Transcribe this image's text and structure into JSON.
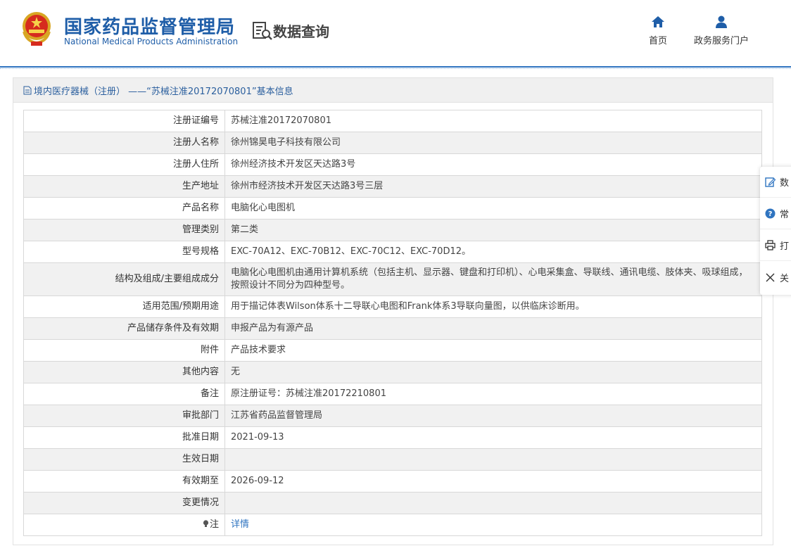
{
  "header": {
    "brand_cn": "国家药品监督管理局",
    "brand_en": "National Medical Products Administration",
    "section_title": "数据查询",
    "nav": [
      {
        "label": "首页",
        "icon": "home-icon"
      },
      {
        "label": "政务服务门户",
        "icon": "user-icon"
      }
    ]
  },
  "panel": {
    "title": "境内医疗器械（注册） ——“苏械注准20172070801”基本信息"
  },
  "rows": [
    {
      "label": "注册证编号",
      "value": "苏械注准20172070801"
    },
    {
      "label": "注册人名称",
      "value": "徐州锦昊电子科技有限公司"
    },
    {
      "label": "注册人住所",
      "value": "徐州经济技术开发区天达路3号"
    },
    {
      "label": "生产地址",
      "value": "徐州市经济技术开发区天达路3号三层"
    },
    {
      "label": "产品名称",
      "value": "电脑化心电图机"
    },
    {
      "label": "管理类别",
      "value": "第二类"
    },
    {
      "label": "型号规格",
      "value": "EXC-70A12、EXC-70B12、EXC-70C12、EXC-70D12。"
    },
    {
      "label": "结构及组成/主要组成成分",
      "value": "电脑化心电图机由通用计算机系统（包括主机、显示器、键盘和打印机）、心电采集盒、导联线、通讯电缆、肢体夹、吸球组成，按照设计不同分为四种型号。"
    },
    {
      "label": "适用范围/预期用途",
      "value": "用于描记体表Wilson体系十二导联心电图和Frank体系3导联向量图，以供临床诊断用。"
    },
    {
      "label": "产品储存条件及有效期",
      "value": "申报产品为有源产品"
    },
    {
      "label": "附件",
      "value": "产品技术要求"
    },
    {
      "label": "其他内容",
      "value": "无"
    },
    {
      "label": "备注",
      "value": "原注册证号：苏械注准20172210801"
    },
    {
      "label": "审批部门",
      "value": "江苏省药品监督管理局"
    },
    {
      "label": "批准日期",
      "value": "2021-09-13"
    },
    {
      "label": "生效日期",
      "value": ""
    },
    {
      "label": "有效期至",
      "value": "2026-09-12"
    },
    {
      "label": "变更情况",
      "value": ""
    },
    {
      "label": "注",
      "value": "详情",
      "label_icon": "lightbulb-icon"
    }
  ],
  "sidebar": [
    {
      "label": "数",
      "icon": "edit-icon"
    },
    {
      "label": "常",
      "icon": "question-icon"
    },
    {
      "label": "打",
      "icon": "print-icon"
    },
    {
      "label": "关",
      "icon": "close-icon"
    }
  ],
  "colors": {
    "brand": "#1f5ea8",
    "link": "#2f74c0",
    "stripe": "#f1f1f1"
  }
}
